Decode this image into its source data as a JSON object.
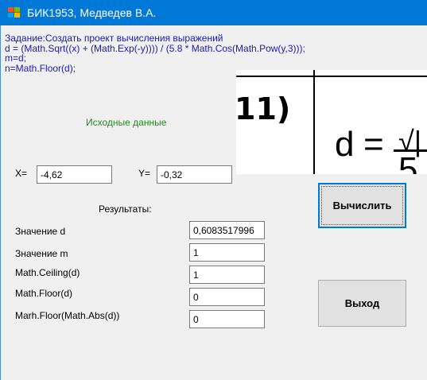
{
  "window": {
    "title": "БИК1953, Медведев В.А."
  },
  "task": {
    "lines": [
      "Задание:Создать проект вычисления выражений",
      "d = (Math.Sqrt((x) + (Math.Exp(-y)))) / (5.8 * Math.Cos(Math.Pow(y,3)));",
      "m=d;",
      "n=Math.Floor(d);"
    ]
  },
  "formula_image": {
    "number": "11)",
    "lhs": "d",
    "eq": "=",
    "root": "√|",
    "denominator_start": "5"
  },
  "inputs": {
    "heading": "Исходные данные",
    "x_label": "X=",
    "x_value": "-4,62",
    "y_label": "Y=",
    "y_value": "-0,32"
  },
  "results": {
    "heading": "Результаты:",
    "rows": [
      {
        "label": "Значение d",
        "value": "0,6083517996"
      },
      {
        "label": "Значение m",
        "value": "1"
      },
      {
        "label": "Math.Ceiling(d)",
        "value": "1"
      },
      {
        "label": "Math.Floor(d)",
        "value": "0"
      },
      {
        "label": "Marh.Floor(Math.Abs(d))",
        "value": "0"
      }
    ]
  },
  "buttons": {
    "calculate": "Вычислить",
    "exit": "Выход"
  },
  "colors": {
    "titlebar": "#0078d7",
    "task_text": "#1a1ab4",
    "heading_green": "#1a8f1a",
    "window_bg": "#f0f0f0"
  }
}
